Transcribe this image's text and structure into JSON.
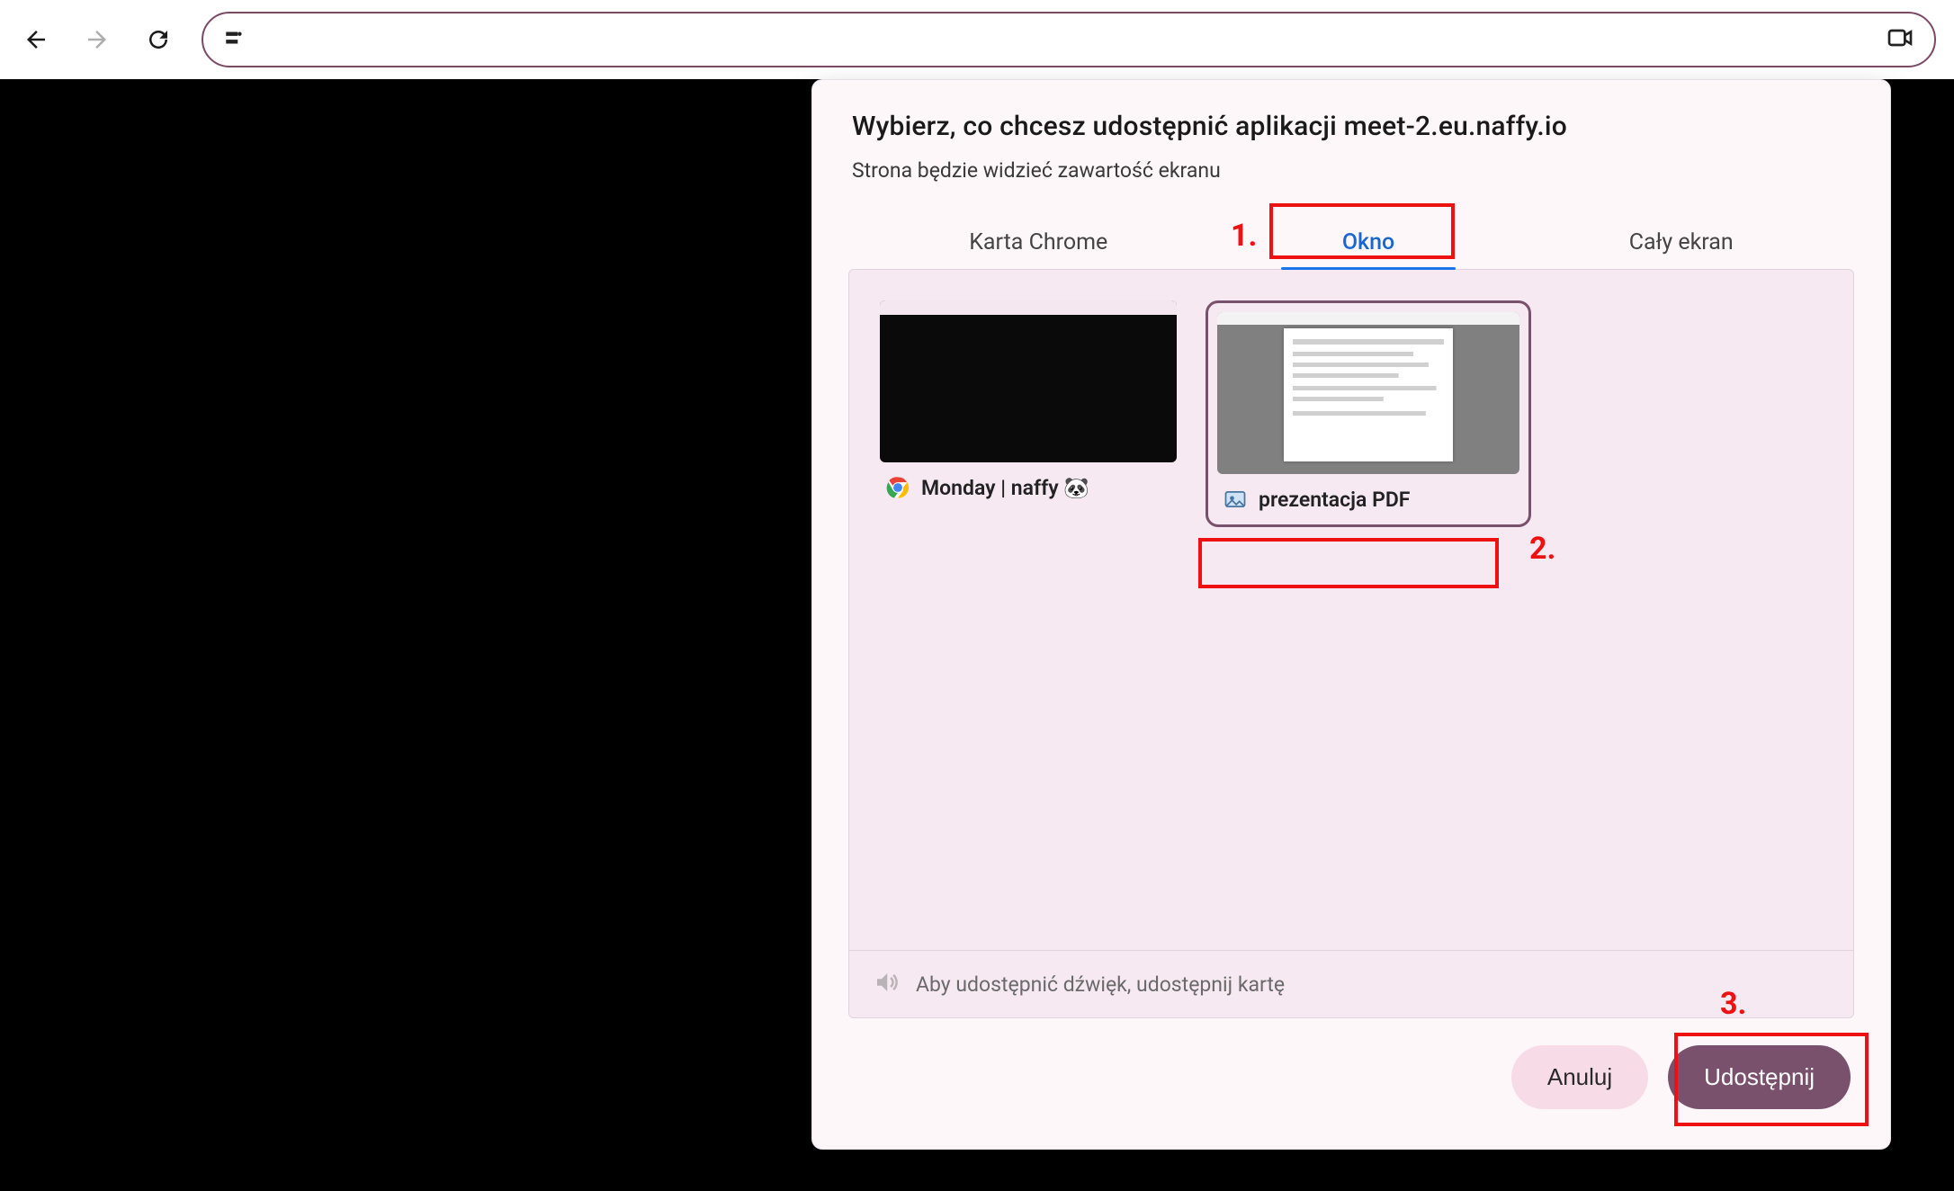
{
  "toolbar": {},
  "modal": {
    "title": "Wybierz, co chcesz udostępnić aplikacji meet-2.eu.naffy.io",
    "subtitle": "Strona będzie widzieć zawartość ekranu",
    "tabs": {
      "chrome_tab": "Karta Chrome",
      "window": "Okno",
      "entire_screen": "Cały ekran"
    },
    "sources": [
      {
        "label": "Monday | naffy 🐼"
      },
      {
        "label": "prezentacja PDF"
      }
    ],
    "audio_hint": "Aby udostępnić dźwięk, udostępnij kartę",
    "buttons": {
      "cancel": "Anuluj",
      "share": "Udostępnij"
    }
  },
  "annotations": {
    "one": "1.",
    "two": "2.",
    "three": "3."
  }
}
